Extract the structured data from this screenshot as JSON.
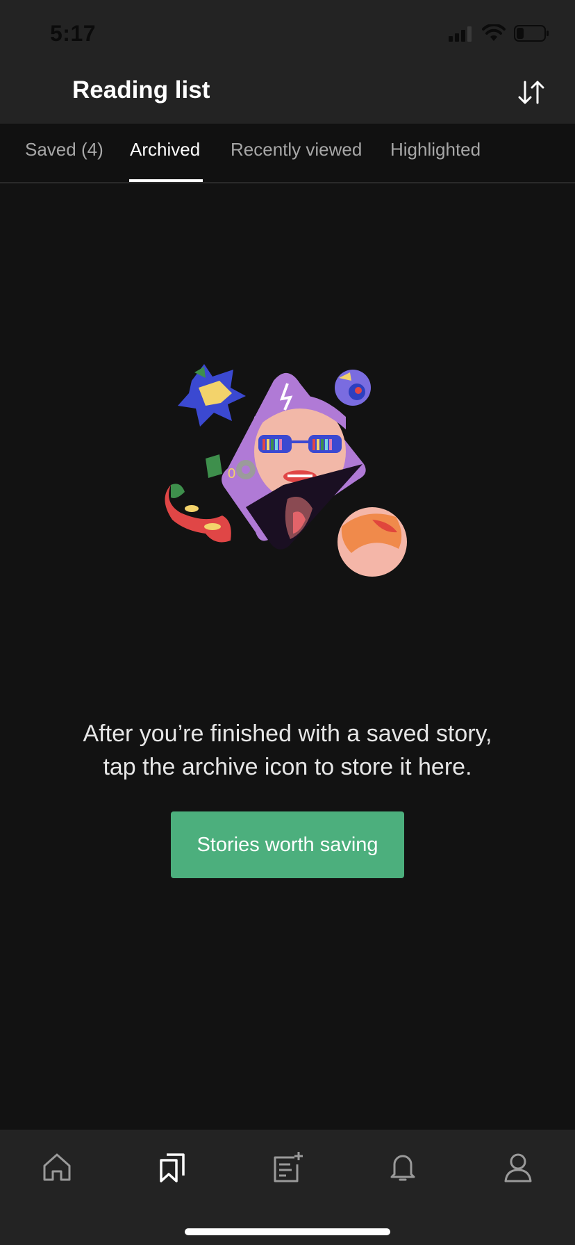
{
  "status_bar": {
    "time": "5:17",
    "icons": [
      "signal-icon",
      "wifi-icon",
      "battery-icon"
    ]
  },
  "header": {
    "title": "Reading list",
    "sort_icon": "sort-arrows-icon"
  },
  "tabs": [
    {
      "label": "Saved (4)",
      "active": false
    },
    {
      "label": "Archived",
      "active": true
    },
    {
      "label": "Recently viewed",
      "active": false
    },
    {
      "label": "Highlighted",
      "active": false
    }
  ],
  "empty_state": {
    "illustration": "collage-illustration",
    "message_line1": "After you’re finished with a saved story,",
    "message_line2": "tap the archive icon to store it here.",
    "button_label": "Stories worth saving"
  },
  "bottom_nav": {
    "items": [
      {
        "icon": "home-icon",
        "active": false
      },
      {
        "icon": "bookmarks-icon",
        "active": true
      },
      {
        "icon": "write-story-icon",
        "active": false
      },
      {
        "icon": "bell-icon",
        "active": false
      },
      {
        "icon": "profile-icon",
        "active": false
      }
    ]
  },
  "colors": {
    "background": "#121212",
    "bar": "#232323",
    "accent": "#4caf7d",
    "inactive_text": "#a7a7a7",
    "active_text": "#ffffff"
  }
}
